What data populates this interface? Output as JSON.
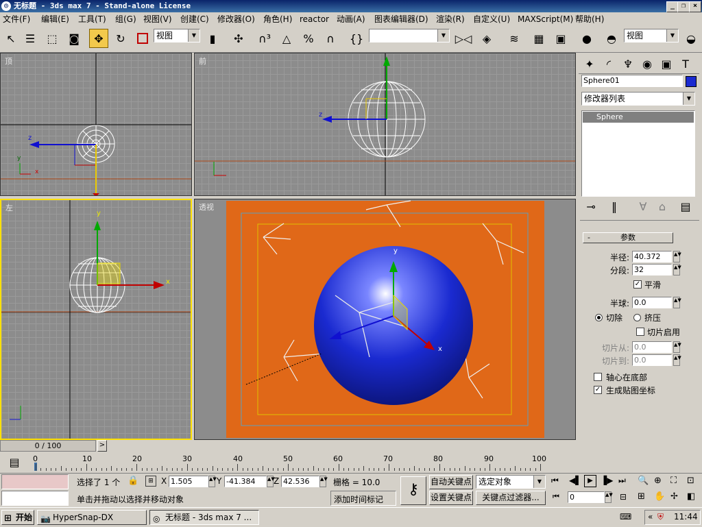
{
  "window": {
    "title": "无标题 - 3ds max 7  - Stand-alone License",
    "min": "_",
    "max": "❐",
    "close": "×"
  },
  "menu": [
    "文件(F)",
    "编辑(E)",
    "工具(T)",
    "组(G)",
    "视图(V)",
    "创建(C)",
    "修改器(O)",
    "角色(H)",
    "reactor",
    "动画(A)",
    "图表编辑器(D)",
    "渲染(R)",
    "自定义(U)",
    "MAXScript(M)",
    "帮助(H)"
  ],
  "toolbar": {
    "ref_coord": "视图",
    "named_sel": "",
    "view_combo": "视图"
  },
  "viewports": {
    "top": {
      "label": "顶"
    },
    "front": {
      "label": "前"
    },
    "left": {
      "label": "左"
    },
    "persp": {
      "label": "透视"
    }
  },
  "axes": {
    "x": "x",
    "y": "y",
    "z": "z"
  },
  "command_panel": {
    "object_name": "Sphere01",
    "object_color": "#1a2ad0",
    "modifier_list": "修改器列表",
    "stack_item": "Sphere",
    "rollout_title": "参数",
    "rollout_toggle": "-",
    "radius_label": "半径:",
    "radius_value": "40.372",
    "segments_label": "分段:",
    "segments_value": "32",
    "smooth_label": "平滑",
    "hemisphere_label": "半球:",
    "hemisphere_value": "0.0",
    "chop_label": "切除",
    "squash_label": "挤压",
    "slice_on_label": "切片启用",
    "slice_from_label": "切片从:",
    "slice_from_value": "0.0",
    "slice_to_label": "切片到:",
    "slice_to_value": "0.0",
    "base_pivot_label": "轴心在底部",
    "gen_map_label": "生成贴图坐标",
    "smooth_checked": "✓",
    "gen_map_checked": "✓"
  },
  "timeline": {
    "frame_display": "0 / 100",
    "prev": "<",
    "next": ">",
    "ticks": [
      "0",
      "10",
      "20",
      "30",
      "40",
      "50",
      "60",
      "70",
      "80",
      "90",
      "100"
    ]
  },
  "status": {
    "selected": "选择了 1 个",
    "prompt": "单击并拖动以选择并移动对象",
    "x_label": "X",
    "x_value": "1.505",
    "y_label": "Y",
    "y_value": "-41.384",
    "z_label": "Z",
    "z_value": "42.536",
    "grid": "栅格 = 10.0",
    "add_time_tag": "添加时间标记",
    "auto_key": "自动关键点",
    "set_key": "设置关键点",
    "selected_objects": "选定对象",
    "key_filters": "关键点过滤器...",
    "current_frame": "0"
  },
  "taskbar": {
    "start": "开始",
    "tasks": [
      "HyperSnap-DX",
      "无标题 - 3ds max 7 ..."
    ],
    "time": "11:44",
    "tray_arrow": "«"
  }
}
